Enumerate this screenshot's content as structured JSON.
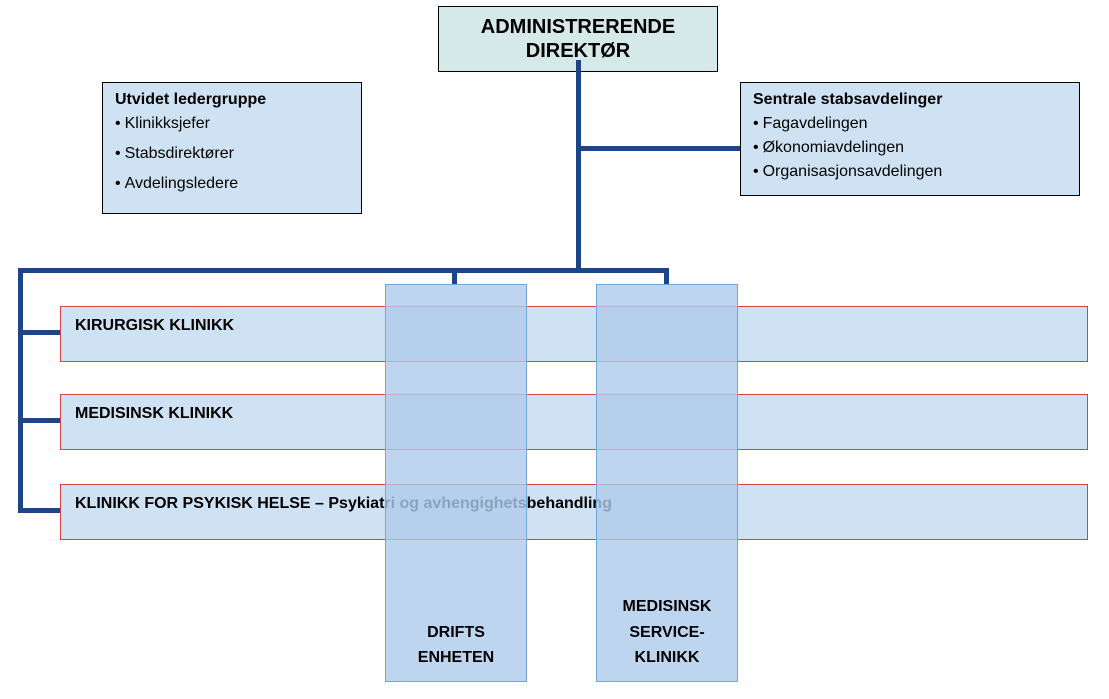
{
  "top": {
    "line1": "ADMINISTRERENDE",
    "line2": "DIREKTØR"
  },
  "left_box": {
    "title": "Utvidet ledergruppe",
    "items": [
      "Klinikksjefer",
      "Stabsdirektører",
      "Avdelingsledere"
    ]
  },
  "right_box": {
    "title": "Sentrale stabsavdelinger",
    "items": [
      "Fagavdelingen",
      "Økonomiavdelingen",
      "Organisasjonsavdelingen"
    ]
  },
  "clinics": [
    "KIRURGISK KLINIKK",
    "MEDISINSK KLINIKK",
    "KLINIKK FOR PSYKISK HELSE – Psykiatri og avhengighetsbehandling"
  ],
  "vertical_units": {
    "drifts": {
      "line1": "DRIFTS",
      "line2": "ENHETEN"
    },
    "medserv": {
      "line1": "MEDISINSK",
      "line2": "SERVICE-",
      "line3": "KLINIKK"
    }
  }
}
